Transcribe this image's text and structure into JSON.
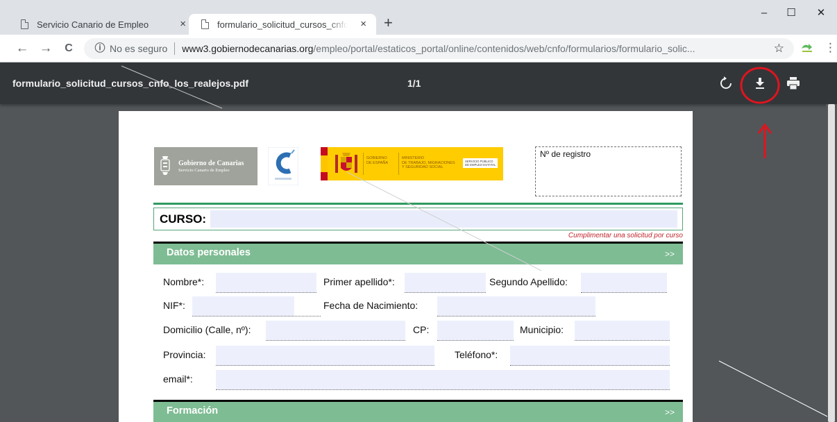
{
  "tabs": [
    {
      "title": "Servicio Canario de Empleo",
      "close": "×",
      "active": false
    },
    {
      "title": "formulario_solicitud_cursos_cnfo_los_realejos.pdf",
      "close": "×",
      "active": true
    }
  ],
  "new_tab": "+",
  "window_controls": {
    "minimize": "–",
    "maximize": "☐",
    "close": "✕"
  },
  "nav": {
    "back": "←",
    "forward": "→",
    "reload": "C"
  },
  "address": {
    "security_icon": "ⓘ",
    "security_text": "No es seguro",
    "host": "www3.gobiernodecanarias.org",
    "path": "/empleo/portal/estaticos_portal/online/contenidos/web/cnfo/formularios/formulario_solic...",
    "star": "☆",
    "menu": "⋮"
  },
  "pdf": {
    "filename": "formulario_solicitud_cursos_cnfo_los_realejos.pdf",
    "page_indicator": "1/1",
    "rotate_icon": "rotate-icon",
    "download_icon": "download-icon",
    "print_icon": "print-icon"
  },
  "document": {
    "logos": {
      "gobierno_main": "Gobierno de Canarias",
      "gobierno_sub": "Servicio Canario de Empleo",
      "gobierno_espana": "GOBIERNO\nDE ESPAÑA",
      "ministerio": "MINISTERIO\nDE TRABAJO, MIGRACIONES\nY SEGURIDAD SOCIAL",
      "sepe": "SERVICIO PÚBLICO\nDE EMPLEO ESTATAL"
    },
    "registro_label": "Nº de registro",
    "curso_label": "CURSO:",
    "note": "Cumplimentar una solicitud por curso",
    "sections": {
      "datos_personales": "Datos personales",
      "formacion": "Formación",
      "arrow": ">>"
    },
    "fields": {
      "nombre": "Nombre*:",
      "primer_apellido": "Primer apellido*:",
      "segundo_apellido": "Segundo Apellido:",
      "nif": "NIF*:",
      "fecha_nacimiento": "Fecha de Nacimiento:",
      "domicilio": "Domicilio (Calle, nº):",
      "cp": "CP:",
      "municipio": "Municipio:",
      "provincia": "Provincia:",
      "telefono": "Teléfono*:",
      "email": "email*:"
    }
  },
  "colors": {
    "tab_strip": "#dee1e6",
    "pdf_toolbar": "#323639",
    "viewer_bg": "#525659",
    "section_green": "#7ebc93",
    "field_fill": "#edf0fc",
    "annotation_red": "#e0141e"
  }
}
